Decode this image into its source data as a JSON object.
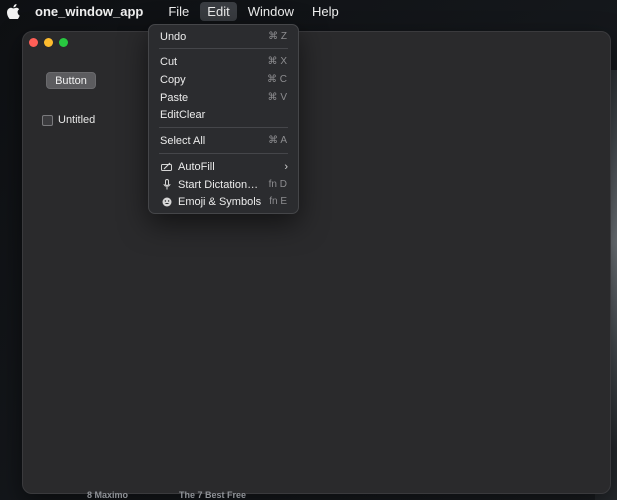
{
  "menubar": {
    "app_name": "one_window_app",
    "menus": [
      "File",
      "Edit",
      "Window",
      "Help"
    ]
  },
  "window": {
    "button_label": "Button",
    "checkbox_label": "Untitled"
  },
  "edit_menu": {
    "items": [
      {
        "label": "Undo",
        "shortcut": "⌘ Z"
      },
      {
        "label": "Cut",
        "shortcut": "⌘ X"
      },
      {
        "label": "Copy",
        "shortcut": "⌘ C"
      },
      {
        "label": "Paste",
        "shortcut": "⌘ V"
      },
      {
        "label": "EditClear",
        "shortcut": ""
      },
      {
        "label": "Select All",
        "shortcut": "⌘ A"
      },
      {
        "label": "AutoFill",
        "shortcut": ""
      },
      {
        "label": "Start Dictation…",
        "shortcut": "fn D"
      },
      {
        "label": "Emoji & Symbols",
        "shortcut": "fn E"
      }
    ]
  },
  "dock": {
    "left_text": "8 Maximo",
    "right_text": "The 7 Best Free"
  },
  "colors": {
    "accent_close": "#ff5f57",
    "accent_min": "#febc2e",
    "accent_max": "#28c840"
  }
}
